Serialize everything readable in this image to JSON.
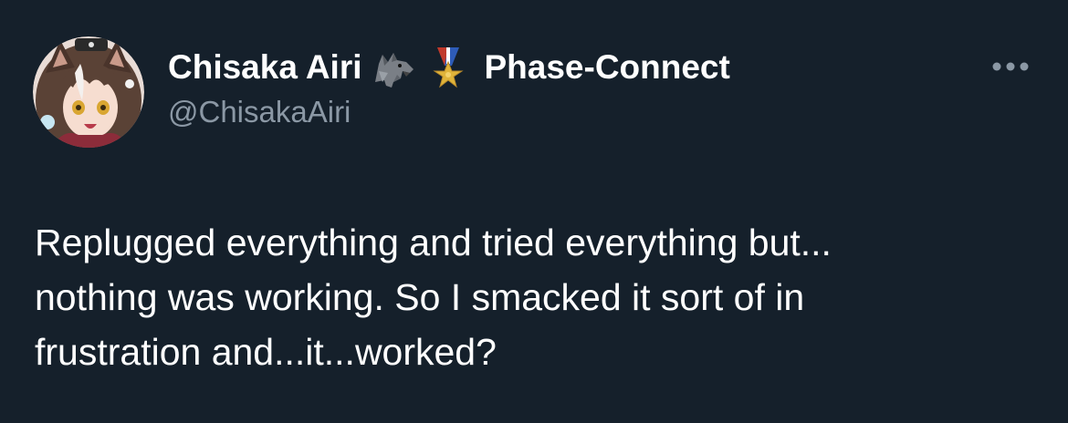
{
  "tweet": {
    "author": {
      "display_name": "Chisaka Airi",
      "affiliation": "Phase-Connect",
      "handle": "@ChisakaAiri",
      "badges": [
        "wolf-icon",
        "military-medal-icon"
      ]
    },
    "text": "Replugged everything and tried everything but...\nnothing was working. So I smacked it sort of in\nfrustration and...it...worked?",
    "more_icon": "more-horizontal-icon"
  },
  "colors": {
    "background": "#15202b",
    "text_primary": "#ffffff",
    "text_secondary": "#8b98a5"
  }
}
